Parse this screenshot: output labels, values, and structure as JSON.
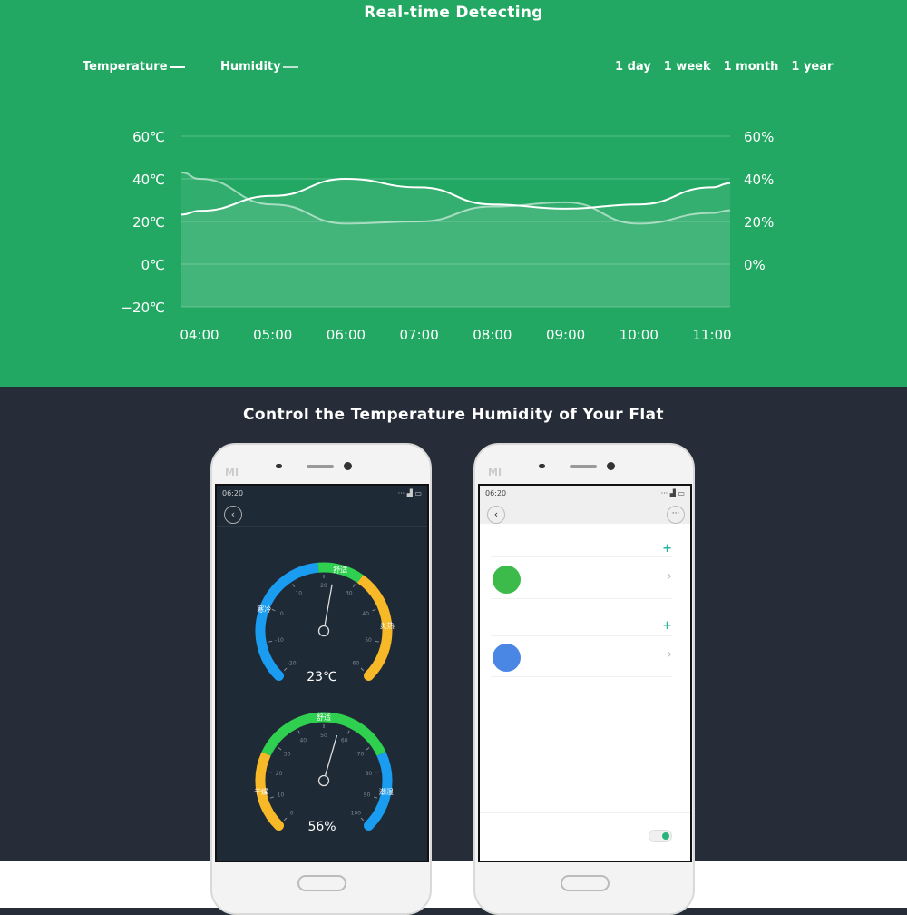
{
  "top": {
    "title": "Real-time Detecting",
    "legend": [
      {
        "label": "Temperature"
      },
      {
        "label": "Humidity"
      }
    ],
    "ranges": [
      "1 day",
      "1 week",
      "1 month",
      "1 year"
    ],
    "bg": "#22a862"
  },
  "chart_data": {
    "type": "line",
    "x": [
      "04:00",
      "05:00",
      "06:00",
      "07:00",
      "08:00",
      "09:00",
      "10:00",
      "11:00"
    ],
    "left_ticks": [
      "60℃",
      "40℃",
      "20℃",
      "0℃",
      "−20℃"
    ],
    "right_ticks": [
      "60%",
      "40%",
      "20%",
      "0%"
    ],
    "ylim_left": [
      -20,
      60
    ],
    "ylim_right": [
      -20,
      60
    ],
    "grid": true,
    "legend": "top-left",
    "series": [
      {
        "name": "Temperature",
        "axis": "left",
        "values": [
          25,
          32,
          40,
          36,
          28,
          26,
          28,
          36
        ]
      },
      {
        "name": "Humidity",
        "axis": "right",
        "values": [
          40,
          28,
          19,
          20,
          27,
          29,
          19,
          24
        ]
      }
    ]
  },
  "bottom": {
    "title": "Control the Temperature Humidity of Your Flat",
    "bg": "#262d38"
  },
  "phone1": {
    "brand": "MI",
    "time": "06:20",
    "back": "‹",
    "temp_gauge": {
      "value": "23℃",
      "reading": 23,
      "zones": [
        "寒冷",
        "舒适",
        "炎热"
      ],
      "ticks": [
        "-20",
        "-10",
        "0",
        "10",
        "20",
        "30",
        "40",
        "50",
        "60"
      ]
    },
    "hum_gauge": {
      "value": "56%",
      "reading": 56,
      "zones": [
        "干燥",
        "舒适",
        "潮湿"
      ],
      "ticks": [
        "0",
        "10",
        "20",
        "30",
        "40",
        "50",
        "60",
        "70",
        "80",
        "90",
        "100"
      ]
    },
    "colors": {
      "blue": "#1a9cf0",
      "green": "#2fcf4f",
      "yellow": "#f7b928"
    }
  },
  "phone2": {
    "brand": "MI",
    "time": "06:20",
    "back": "‹",
    "more": "···",
    "plus": "+",
    "chevron": "›",
    "devices": [
      {
        "color": "#3dbb4a"
      },
      {
        "color": "#4a86e3"
      }
    ],
    "toggle_color": "#27b37a"
  }
}
